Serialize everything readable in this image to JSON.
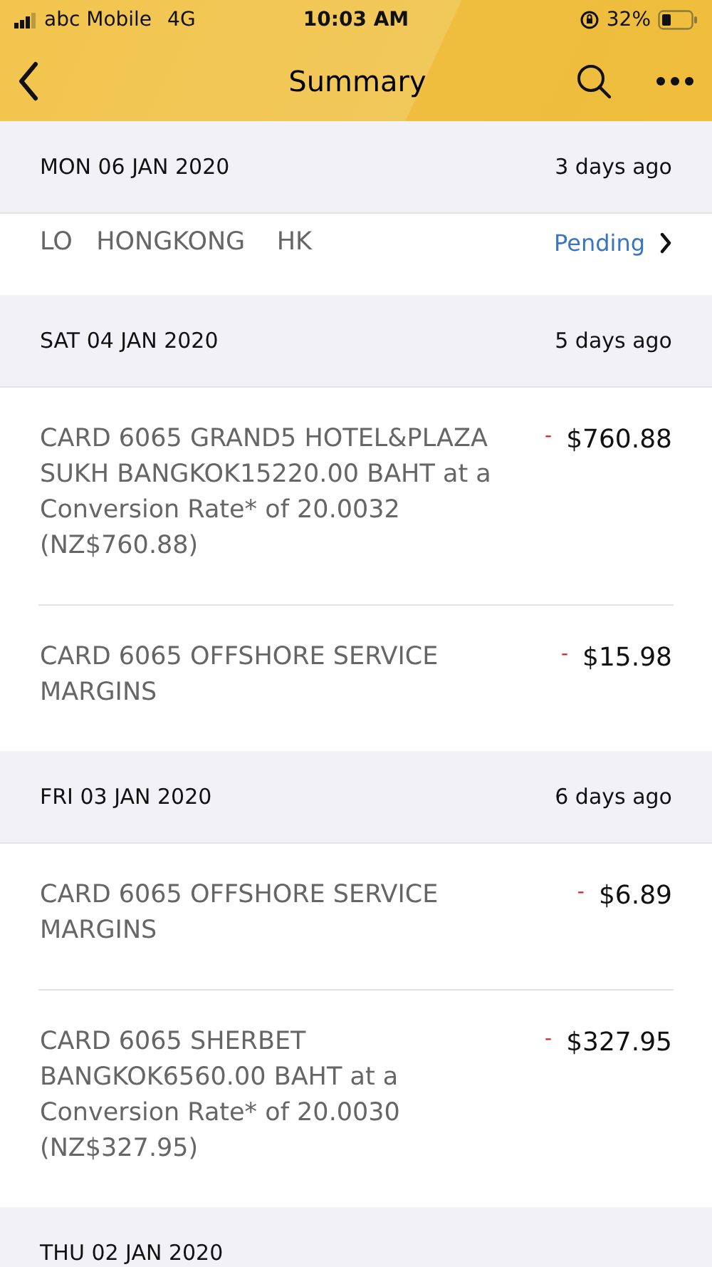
{
  "status_bar": {
    "carrier": "abc Mobile",
    "network": "4G",
    "time": "10:03 AM",
    "battery": "32%"
  },
  "nav": {
    "title": "Summary"
  },
  "groups": [
    {
      "date": "MON 06 JAN 2020",
      "ago": "3 days ago",
      "items": [
        {
          "kind": "pending",
          "description": "LO   HONGKONG    HK",
          "status": "Pending"
        }
      ]
    },
    {
      "date": "SAT 04 JAN 2020",
      "ago": "5 days ago",
      "items": [
        {
          "kind": "debit",
          "description": "CARD 6065 GRAND5 HOTEL&PLAZA SUKH BANGKOK15220.00 BAHT at a Conversion Rate* of 20.0032 (NZ$760.88)",
          "sign": "-",
          "amount": "$760.88"
        },
        {
          "kind": "debit",
          "description": "CARD 6065 OFFSHORE SERVICE MARGINS",
          "sign": "-",
          "amount": "$15.98"
        }
      ]
    },
    {
      "date": "FRI 03 JAN 2020",
      "ago": "6 days ago",
      "items": [
        {
          "kind": "debit",
          "description": "CARD 6065 OFFSHORE SERVICE MARGINS",
          "sign": "-",
          "amount": "$6.89"
        },
        {
          "kind": "debit",
          "description": "CARD 6065 SHERBET BANGKOK6560.00 BAHT at a Conversion Rate* of 20.0030 (NZ$327.95)",
          "sign": "-",
          "amount": "$327.95"
        }
      ]
    },
    {
      "date": "THU 02 JAN 2020"
    }
  ]
}
